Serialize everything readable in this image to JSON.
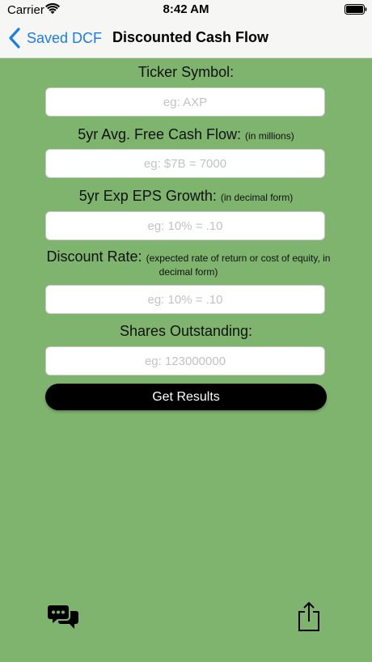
{
  "status_bar": {
    "carrier": "Carrier",
    "time": "8:42 AM",
    "wifi_icon": "wifi-icon",
    "battery_icon": "battery-icon"
  },
  "nav": {
    "back_label": "Saved DCF",
    "back_icon": "chevron-left-icon",
    "title": "Discounted Cash Flow"
  },
  "form": {
    "ticker": {
      "label": "Ticker Symbol:",
      "value": "",
      "placeholder": "eg: AXP"
    },
    "free_cash_flow": {
      "label": "5yr Avg. Free Cash Flow:",
      "note": "(in millions)",
      "value": "",
      "placeholder": "eg: $7B = 7000"
    },
    "eps_growth": {
      "label": "5yr Exp EPS Growth:",
      "note": "(in decimal form)",
      "value": "",
      "placeholder": "eg: 10% = .10"
    },
    "discount_rate": {
      "label": "Discount Rate:",
      "note": "(expected rate of return or cost of equity, in decimal form)",
      "value": "",
      "placeholder": "eg: 10% = .10"
    },
    "shares_outstanding": {
      "label": "Shares Outstanding:",
      "value": "",
      "placeholder": "eg: 123000000"
    },
    "submit_label": "Get Results"
  },
  "toolbar": {
    "left_icon": "chat-bubbles-icon",
    "right_icon": "share-icon"
  },
  "colors": {
    "background": "#7fb46e",
    "bar": "#f6f7f5",
    "accent": "#1a7cf2",
    "button": "#000000"
  }
}
